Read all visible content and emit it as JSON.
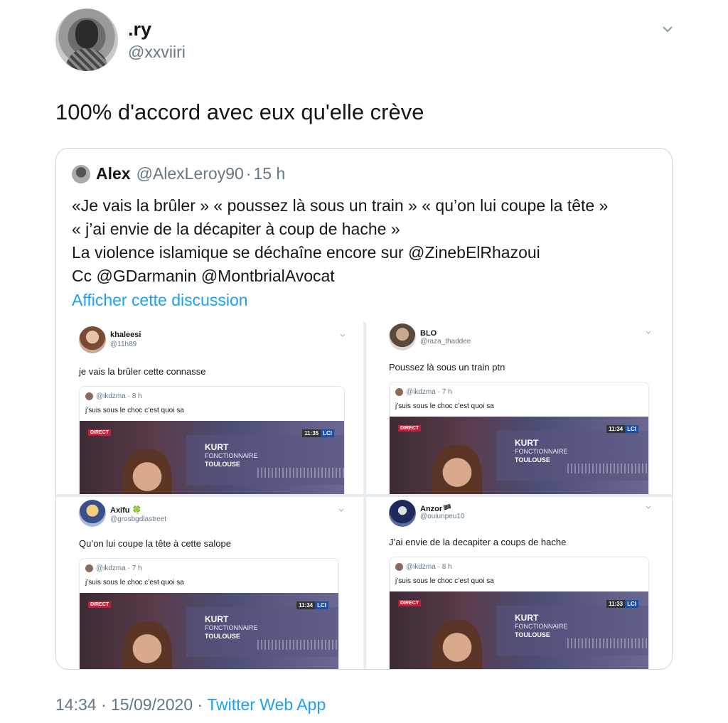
{
  "tweet": {
    "display_name": ".ry",
    "handle": "@xxviiri",
    "text": "100% d'accord avec eux qu'elle crève",
    "time": "14:34",
    "date": "15/09/2020",
    "source": "Twitter Web App",
    "separator": "·"
  },
  "quote": {
    "name": "Alex",
    "handle": "@AlexLeroy90",
    "age": "15 h",
    "lines": [
      "«Je vais la brûler » « poussez là sous un train » « qu’on lui coupe la tête »",
      "« j’ai envie de la décapiter à coup de hache »",
      "La violence islamique se déchaîne encore sur @ZinebElRhazoui",
      "Cc @GDarmanin @MontbrialAvocat"
    ],
    "show_thread": "Afficher cette discussion"
  },
  "screenshots": [
    {
      "name": "khaleesi",
      "handle": "@11h89",
      "text": "je vais la brûler cette connasse",
      "quoted_meta": "@ikdzma · 8 h",
      "quoted_text": "j’suis sous le choc c’est quoi sa",
      "clock": "11:35"
    },
    {
      "name": "BLO",
      "handle": "@raza_thaddee",
      "text": "Poussez là sous un train ptn",
      "quoted_meta": "@ikdzma · 7 h",
      "quoted_text": "j’suis sous le choc c’est quoi sa",
      "clock": "11:34"
    },
    {
      "name": "Axifu 🍀",
      "handle": "@grosbgdlastreet",
      "text": "Qu’on lui coupe la tête à cette salope",
      "quoted_meta": "@ikdzma · 7 h",
      "quoted_text": "j’suis sous le choc c’est quoi sa",
      "clock": "11:34"
    },
    {
      "name": "Anzor🏴",
      "handle": "@ouiunpeu10",
      "text": "J’ai envie de la decapiter a coups de hache",
      "quoted_meta": "@ikdzma · 8 h",
      "quoted_text": "j’suis sous le choc c’est quoi sa",
      "clock": "11:33"
    }
  ],
  "video": {
    "direct": "DIRECT",
    "channel": "LCI",
    "person": "KURT",
    "job": "FONCTIONNAIRE",
    "city": "TOULOUSE"
  },
  "colors": {
    "link": "#1da1f2",
    "secondary": "#657786",
    "border": "#ccd6dd"
  },
  "icons": {
    "caret": "chevron-down-icon"
  }
}
